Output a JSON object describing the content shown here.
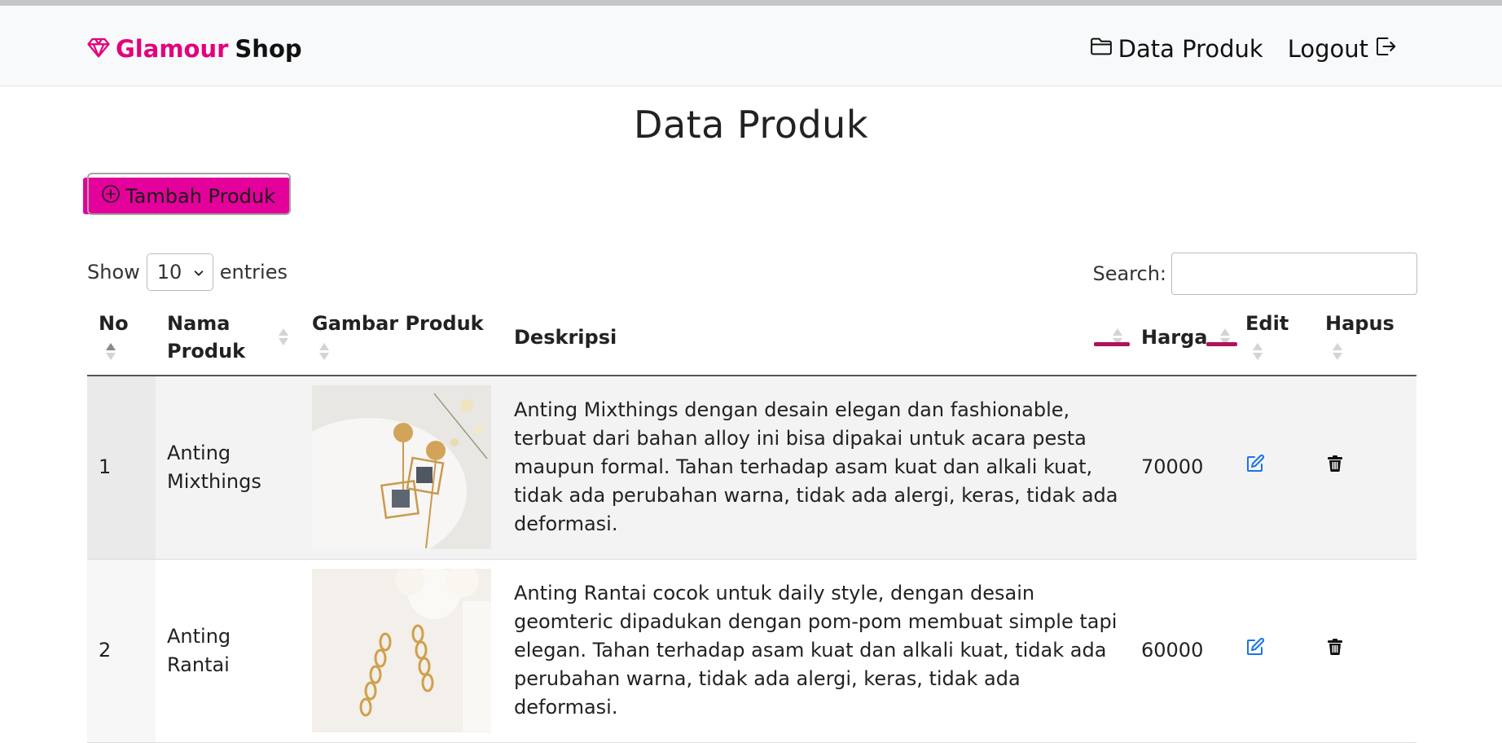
{
  "brand": {
    "part1": "Glamour",
    "part2": "Shop",
    "icon": "gem-icon",
    "color": "#e4007c"
  },
  "nav": [
    {
      "label": "Data Produk",
      "icon": "folder-icon"
    },
    {
      "label": "Logout",
      "icon": "logout-icon"
    }
  ],
  "page": {
    "title": "Data Produk"
  },
  "add_button": {
    "label": "Tambah Produk",
    "icon": "plus-circle-icon",
    "color": "#e4009a"
  },
  "length_menu": {
    "show": "Show",
    "value": "10",
    "suffix": "entries"
  },
  "search": {
    "label": "Search:",
    "value": "",
    "placeholder": ""
  },
  "table": {
    "columns": [
      "No",
      "Nama Produk",
      "Gambar Produk",
      "Deskripsi",
      "Harga",
      "Edit",
      "Hapus"
    ],
    "rows": [
      {
        "no": "1",
        "name": "Anting Mixthings",
        "description": "Anting Mixthings dengan desain elegan dan fashionable, terbuat dari bahan alloy ini bisa dipakai untuk acara pesta maupun formal. Tahan terhadap asam kuat dan alkali kuat, tidak ada perubahan warna, tidak ada alergi, keras, tidak ada deformasi.",
        "price": "70000"
      },
      {
        "no": "2",
        "name": "Anting Rantai",
        "description": "Anting Rantai cocok untuk daily style, dengan desain geomteric dipadukan dengan pom-pom membuat simple tapi elegan. Tahan terhadap asam kuat dan alkali kuat, tidak ada perubahan warna, tidak ada alergi, keras, tidak ada deformasi.",
        "price": "60000"
      }
    ]
  },
  "colors": {
    "accent": "#e4007c",
    "edit_icon": "#1a73e8",
    "underline": "#b0125e"
  }
}
